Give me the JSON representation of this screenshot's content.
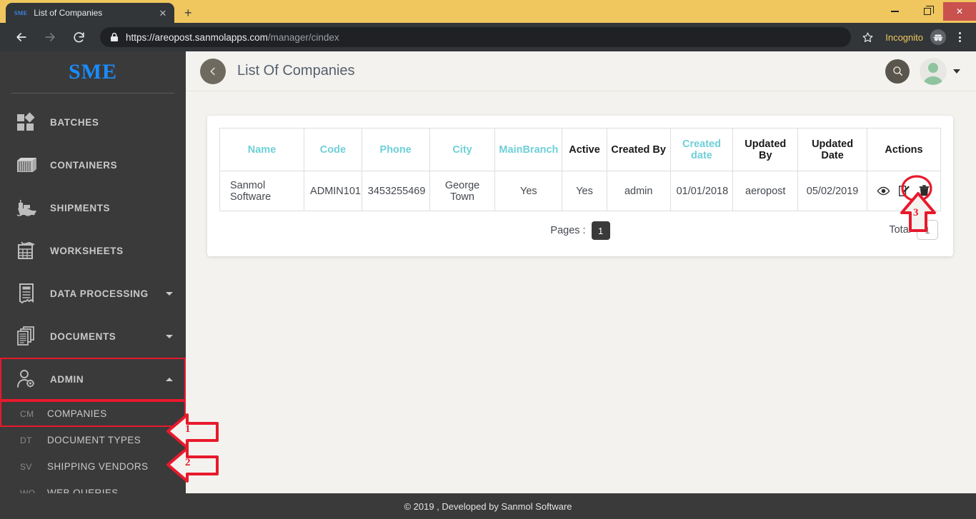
{
  "browser": {
    "tab": {
      "favicon_text": "SME",
      "title": "List of Companies",
      "close_icon": "close-icon"
    },
    "new_tab_label": "+",
    "window": {
      "minimize": "–",
      "maximize": "□",
      "close": "✕"
    },
    "nav": {
      "back": "back-arrow-icon",
      "forward": "forward-arrow-icon",
      "reload": "reload-icon"
    },
    "omnibox": {
      "lock_icon": "lock-icon",
      "url_host": "https://areopost.sanmolapps.com",
      "url_path": "/manager/cindex",
      "star_icon": "bookmark-star-icon"
    },
    "incognito_label": "Incognito",
    "incognito_icon": "incognito-icon",
    "menu_icon": "three-dot-menu-icon"
  },
  "sidebar": {
    "brand": "SME",
    "items": [
      {
        "label": "BATCHES",
        "icon": "batches-icon",
        "has_caret": false
      },
      {
        "label": "CONTAINERS",
        "icon": "container-icon",
        "has_caret": false
      },
      {
        "label": "SHIPMENTS",
        "icon": "ship-icon",
        "has_caret": false
      },
      {
        "label": "WORKSHEETS",
        "icon": "worksheet-icon",
        "has_caret": false
      },
      {
        "label": "DATA PROCESSING",
        "icon": "data-processing-icon",
        "has_caret": true
      },
      {
        "label": "DOCUMENTS",
        "icon": "documents-icon",
        "has_caret": true
      },
      {
        "label": "ADMIN",
        "icon": "admin-user-gear-icon",
        "has_caret": true
      }
    ],
    "subitems": [
      {
        "abbr": "CM",
        "label": "COMPANIES"
      },
      {
        "abbr": "DT",
        "label": "DOCUMENT TYPES"
      },
      {
        "abbr": "SV",
        "label": "SHIPPING VENDORS"
      },
      {
        "abbr": "WQ",
        "label": "WEB QUERIES"
      }
    ]
  },
  "header": {
    "back_icon": "chevron-left-icon",
    "title": "List Of Companies",
    "search_icon": "search-icon",
    "avatar_icon": "user-avatar-icon",
    "avatar_caret_icon": "chevron-down-icon"
  },
  "table": {
    "columns": [
      {
        "label": "Name",
        "sortable": true
      },
      {
        "label": "Code",
        "sortable": true
      },
      {
        "label": "Phone",
        "sortable": true
      },
      {
        "label": "City",
        "sortable": true
      },
      {
        "label": "MainBranch",
        "sortable": true
      },
      {
        "label": "Active",
        "sortable": false
      },
      {
        "label": "Created By",
        "sortable": false
      },
      {
        "label": "Created date",
        "sortable": true
      },
      {
        "label": "Updated By",
        "sortable": false
      },
      {
        "label": "Updated Date",
        "sortable": false
      },
      {
        "label": "Actions",
        "sortable": false
      }
    ],
    "rows": [
      {
        "name": "Sanmol Software",
        "code": "ADMIN101",
        "phone": "3453255469",
        "city": "George Town",
        "mainbranch": "Yes",
        "active": "Yes",
        "created_by": "admin",
        "created_date": "01/01/2018",
        "updated_by": "aeropost",
        "updated_date": "05/02/2019",
        "actions": [
          "view-eye-icon",
          "edit-pencil-icon",
          "delete-trash-icon"
        ]
      }
    ],
    "pages_label": "Pages :",
    "page_value": "1",
    "total_label": "Total",
    "total_value": "1"
  },
  "footer": {
    "text": "© 2019 , Developed by Sanmol Software"
  },
  "annotations": [
    {
      "number": "1",
      "target": "sidebar-item-admin"
    },
    {
      "number": "2",
      "target": "sidebar-subitem-companies"
    },
    {
      "number": "3",
      "target": "row-edit-icon"
    }
  ],
  "colors": {
    "annotation_red": "#e8192c",
    "brand_blue": "#1a8cff",
    "sortable_teal": "#6fd0d8",
    "sidebar_dark": "#3a3a3a",
    "incognito_yellow": "#efc75e"
  }
}
